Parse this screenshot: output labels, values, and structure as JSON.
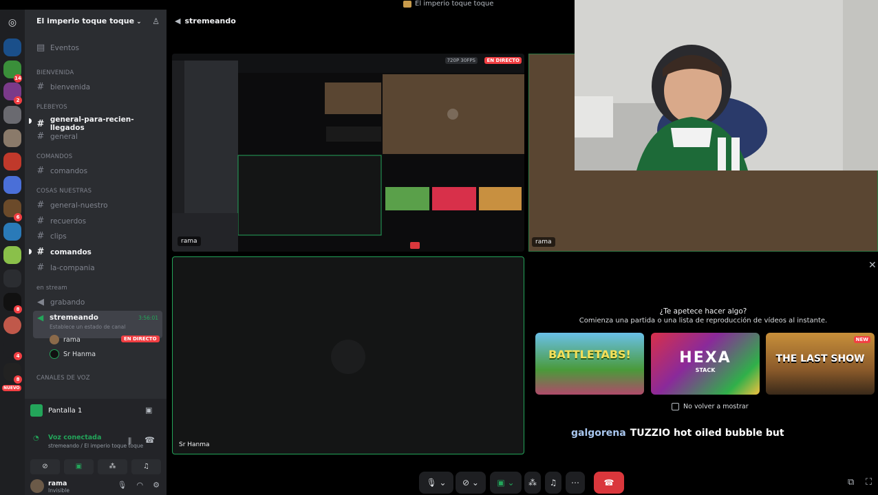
{
  "window": {
    "title": "El imperio toque toque"
  },
  "server": {
    "name": "El imperio toque toque"
  },
  "sidebar": {
    "events_label": "Eventos",
    "categories": {
      "bienvenida": "BIENVENIDA",
      "plebeyos": "PLEBEYOS",
      "comandos": "COMANDOS",
      "cosas": "COSAS NUESTRAS",
      "stream": "en stream",
      "voz": "CANALES DE VOZ"
    },
    "channels": {
      "bienvenida": "bienvenida",
      "general_nuevos": "general-para-recien-llegados",
      "general": "general",
      "comandos1": "comandos",
      "general_nuestro": "general-nuestro",
      "recuerdos": "recuerdos",
      "clips": "clips",
      "comandos2": "comandos",
      "compania": "la-compania",
      "grabando": "grabando"
    },
    "active_voice": {
      "name": "stremeando",
      "status": "Establece un estado de canal",
      "timer": "3:56:01"
    },
    "voice_users": [
      {
        "name": "rama",
        "badge": "EN DIRECTO"
      },
      {
        "name": "Sr Hanma"
      }
    ],
    "server_badges": [
      "14",
      "2",
      "6",
      "8",
      "4",
      "8",
      "3"
    ],
    "new_badge": "NUEVO"
  },
  "panel": {
    "screen_label": "Pantalla 1",
    "voice_status": "Voz conectada",
    "voice_location": "stremeando / El imperio toque toque"
  },
  "user": {
    "name": "rama",
    "status": "Invisible"
  },
  "channel_header": {
    "name": "stremeando"
  },
  "stage": {
    "stream_label": "rama",
    "quality": "720P 30FPS",
    "live": "EN DIRECTO",
    "rama_label": "rama",
    "hanma_label": "Sr Hanma"
  },
  "activity": {
    "question": "¿Te apetece hacer algo?",
    "subtitle": "Comienza una partida o una lista de reproducción de vídeos al instante.",
    "games": [
      {
        "name": "BATTLETABS!"
      },
      {
        "name": "HEXA",
        "sub": "STACK"
      },
      {
        "name": "THE LAST SHOW",
        "badge": "NEW"
      }
    ],
    "dont_show": "No volver a mostrar"
  },
  "chat": {
    "user": "galgorena",
    "message": "TUZZIO hot oiled bubble but"
  },
  "colors": {
    "accent_green": "#23a55a",
    "live_red": "#f23f43",
    "sidebar_bg": "#2b2d31",
    "rail_bg": "#1e1f22"
  },
  "icons": [
    "discord-icon",
    "hash-icon",
    "speaker-icon",
    "mic-icon",
    "camera-off-icon",
    "screen-share-icon",
    "activity-icon",
    "more-icon",
    "hangup-icon",
    "settings-icon",
    "headphones-icon",
    "close-icon",
    "popout-icon",
    "fullscreen-icon"
  ]
}
